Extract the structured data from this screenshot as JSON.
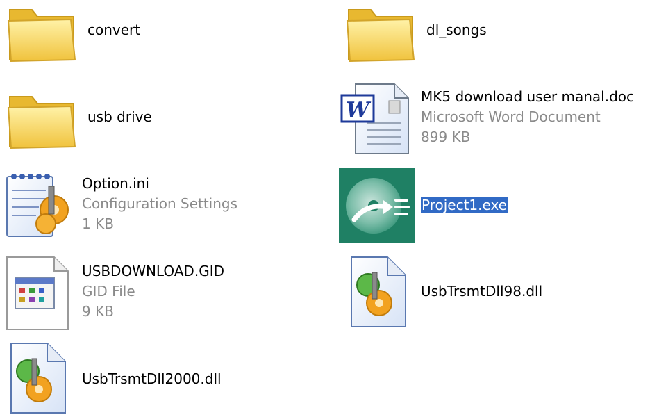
{
  "folder_view": {
    "items": [
      {
        "name": "convert",
        "icon": "folder-icon"
      },
      {
        "name": "dl_songs",
        "icon": "folder-icon"
      },
      {
        "name": "usb drive",
        "icon": "folder-icon"
      },
      {
        "name": "MK5 download user manal.doc",
        "type": "Microsoft Word Document",
        "size": "899 KB",
        "icon": "word-document-icon"
      },
      {
        "name": "Option.ini",
        "type": "Configuration Settings",
        "size": "1 KB",
        "icon": "config-settings-icon"
      },
      {
        "name": "Project1.exe",
        "icon": "cd-application-icon",
        "selected": true
      },
      {
        "name": "USBDOWNLOAD.GID",
        "type": "GID File",
        "size": "9 KB",
        "icon": "gid-file-icon"
      },
      {
        "name": "UsbTrsmtDll98.dll",
        "icon": "dll-file-icon"
      },
      {
        "name": "UsbTrsmtDll2000.dll",
        "icon": "dll-file-icon"
      }
    ]
  },
  "colors": {
    "selection": "#316ac5",
    "folder": "#f7d668",
    "secondary_text": "#8a8a8a",
    "exe_background": "#1f8064"
  }
}
